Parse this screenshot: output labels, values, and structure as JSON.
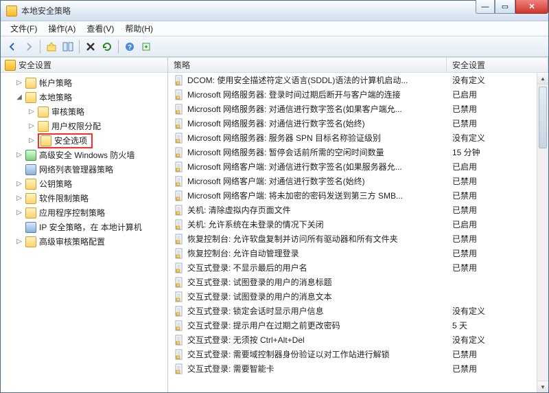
{
  "window": {
    "title": "本地安全策略"
  },
  "menu": {
    "file": "文件(F)",
    "action": "操作(A)",
    "view": "查看(V)",
    "help": "帮助(H)"
  },
  "toolbar_icons": [
    "back",
    "forward",
    "up",
    "show-hide-tree",
    "delete",
    "refresh",
    "help",
    "export"
  ],
  "tree": {
    "header": "安全设置",
    "nodes": [
      {
        "label": "帐户策略",
        "exp": "▷",
        "indent": 1,
        "icon": "folder"
      },
      {
        "label": "本地策略",
        "exp": "◢",
        "indent": 1,
        "icon": "folder",
        "children": [
          {
            "label": "审核策略",
            "exp": "▷",
            "indent": 2,
            "icon": "folder"
          },
          {
            "label": "用户权限分配",
            "exp": "▷",
            "indent": 2,
            "icon": "folder"
          },
          {
            "label": "安全选项",
            "exp": "▷",
            "indent": 2,
            "icon": "folder",
            "highlight": true
          }
        ]
      },
      {
        "label": "高级安全 Windows 防火墙",
        "exp": "▷",
        "indent": 1,
        "icon": "green"
      },
      {
        "label": "网络列表管理器策略",
        "exp": "",
        "indent": 1,
        "icon": "blue"
      },
      {
        "label": "公钥策略",
        "exp": "▷",
        "indent": 1,
        "icon": "folder"
      },
      {
        "label": "软件限制策略",
        "exp": "▷",
        "indent": 1,
        "icon": "folder"
      },
      {
        "label": "应用程序控制策略",
        "exp": "▷",
        "indent": 1,
        "icon": "folder"
      },
      {
        "label": "IP 安全策略，在 本地计算机",
        "exp": "",
        "indent": 1,
        "icon": "blue"
      },
      {
        "label": "高级审核策略配置",
        "exp": "▷",
        "indent": 1,
        "icon": "folder"
      }
    ]
  },
  "list": {
    "col_name": "策略",
    "col_setting": "安全设置",
    "rows": [
      {
        "name": "DCOM: 使用安全描述符定义语言(SDDL)语法的计算机启动...",
        "setting": "没有定义"
      },
      {
        "name": "Microsoft 网络服务器: 登录时间过期后断开与客户端的连接",
        "setting": "已启用"
      },
      {
        "name": "Microsoft 网络服务器: 对通信进行数字签名(如果客户端允...",
        "setting": "已禁用"
      },
      {
        "name": "Microsoft 网络服务器: 对通信进行数字签名(始终)",
        "setting": "已禁用"
      },
      {
        "name": "Microsoft 网络服务器: 服务器 SPN 目标名称验证级别",
        "setting": "没有定义"
      },
      {
        "name": "Microsoft 网络服务器: 暂停会话前所需的空闲时间数量",
        "setting": "15 分钟"
      },
      {
        "name": "Microsoft 网络客户端: 对通信进行数字签名(如果服务器允...",
        "setting": "已启用"
      },
      {
        "name": "Microsoft 网络客户端: 对通信进行数字签名(始终)",
        "setting": "已禁用"
      },
      {
        "name": "Microsoft 网络客户端: 将未加密的密码发送到第三方 SMB...",
        "setting": "已禁用"
      },
      {
        "name": "关机: 清除虚拟内存页面文件",
        "setting": "已禁用"
      },
      {
        "name": "关机: 允许系统在未登录的情况下关闭",
        "setting": "已启用"
      },
      {
        "name": "恢复控制台: 允许软盘复制并访问所有驱动器和所有文件夹",
        "setting": "已禁用"
      },
      {
        "name": "恢复控制台: 允许自动管理登录",
        "setting": "已禁用"
      },
      {
        "name": "交互式登录: 不显示最后的用户名",
        "setting": "已禁用"
      },
      {
        "name": "交互式登录: 试图登录的用户的消息标题",
        "setting": ""
      },
      {
        "name": "交互式登录: 试图登录的用户的消息文本",
        "setting": ""
      },
      {
        "name": "交互式登录: 锁定会话时显示用户信息",
        "setting": "没有定义"
      },
      {
        "name": "交互式登录: 提示用户在过期之前更改密码",
        "setting": "5 天"
      },
      {
        "name": "交互式登录: 无须按 Ctrl+Alt+Del",
        "setting": "没有定义"
      },
      {
        "name": "交互式登录: 需要域控制器身份验证以对工作站进行解锁",
        "setting": "已禁用"
      },
      {
        "name": "交互式登录: 需要智能卡",
        "setting": "已禁用"
      }
    ]
  }
}
